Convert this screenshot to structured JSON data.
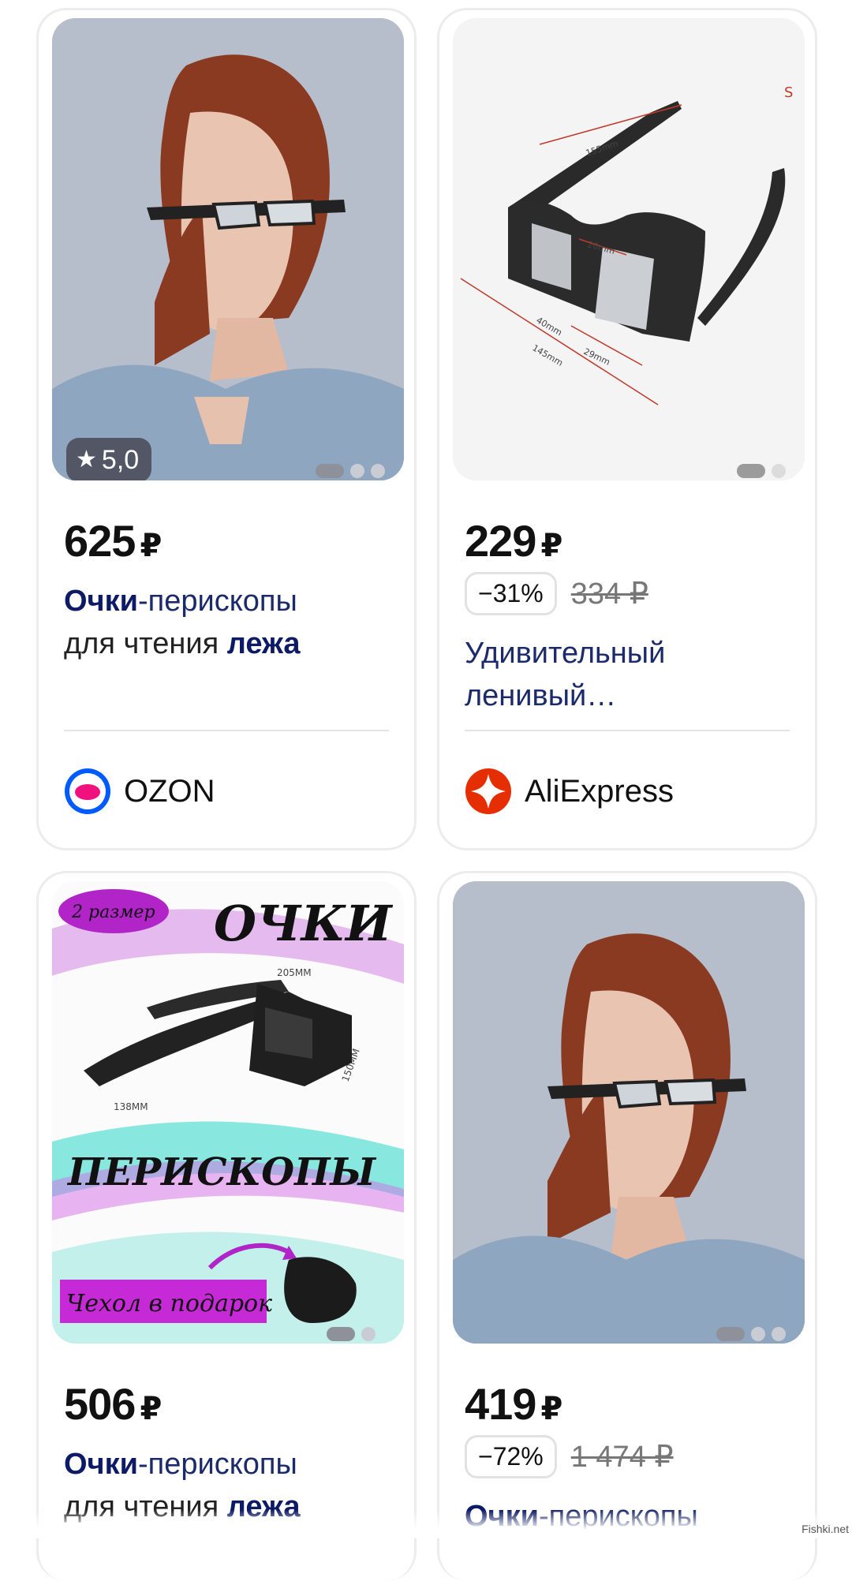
{
  "products": [
    {
      "price": "625",
      "currency": "₽",
      "rating": "5,0",
      "title_bold": "Очки",
      "title_rest": "-перископы",
      "title_line2_plain": "для чтения ",
      "title_line2_bold": "лежа",
      "seller": "OZON",
      "seller_icon": "ozon-logo-icon",
      "image_dots": 3
    },
    {
      "price": "229",
      "currency": "₽",
      "discount": "−31%",
      "old_price": "334 ₽",
      "title_line1": "Удивительный",
      "title_line2": "ленивый…",
      "seller": "AliExpress",
      "seller_icon": "aliexpress-logo-icon",
      "image_dots": 2,
      "image_labels": [
        "155mm",
        "20mm",
        "40mm",
        "145mm",
        "29mm",
        "S"
      ]
    },
    {
      "price": "506",
      "currency": "₽",
      "title_bold": "Очки",
      "title_rest": "-перископы",
      "title_line2_plain": "для чтения ",
      "title_line2_bold": "лежа",
      "image_texts": [
        "2 размер",
        "ОЧКИ",
        "205MM",
        "150MM",
        "138MM",
        "ПЕРИСКОПЫ",
        "Чехол в подарок"
      ],
      "image_dots": 2
    },
    {
      "price": "419",
      "currency": "₽",
      "discount": "−72%",
      "old_price": "1 474 ₽",
      "title_bold": "Очки",
      "title_rest": "-перископы",
      "image_dots": 3
    }
  ],
  "watermark": "Fishki.net",
  "colors": {
    "title_blue": "#1b2a6b",
    "ozon": "#005bff",
    "aliexpress": "#e62e04"
  }
}
